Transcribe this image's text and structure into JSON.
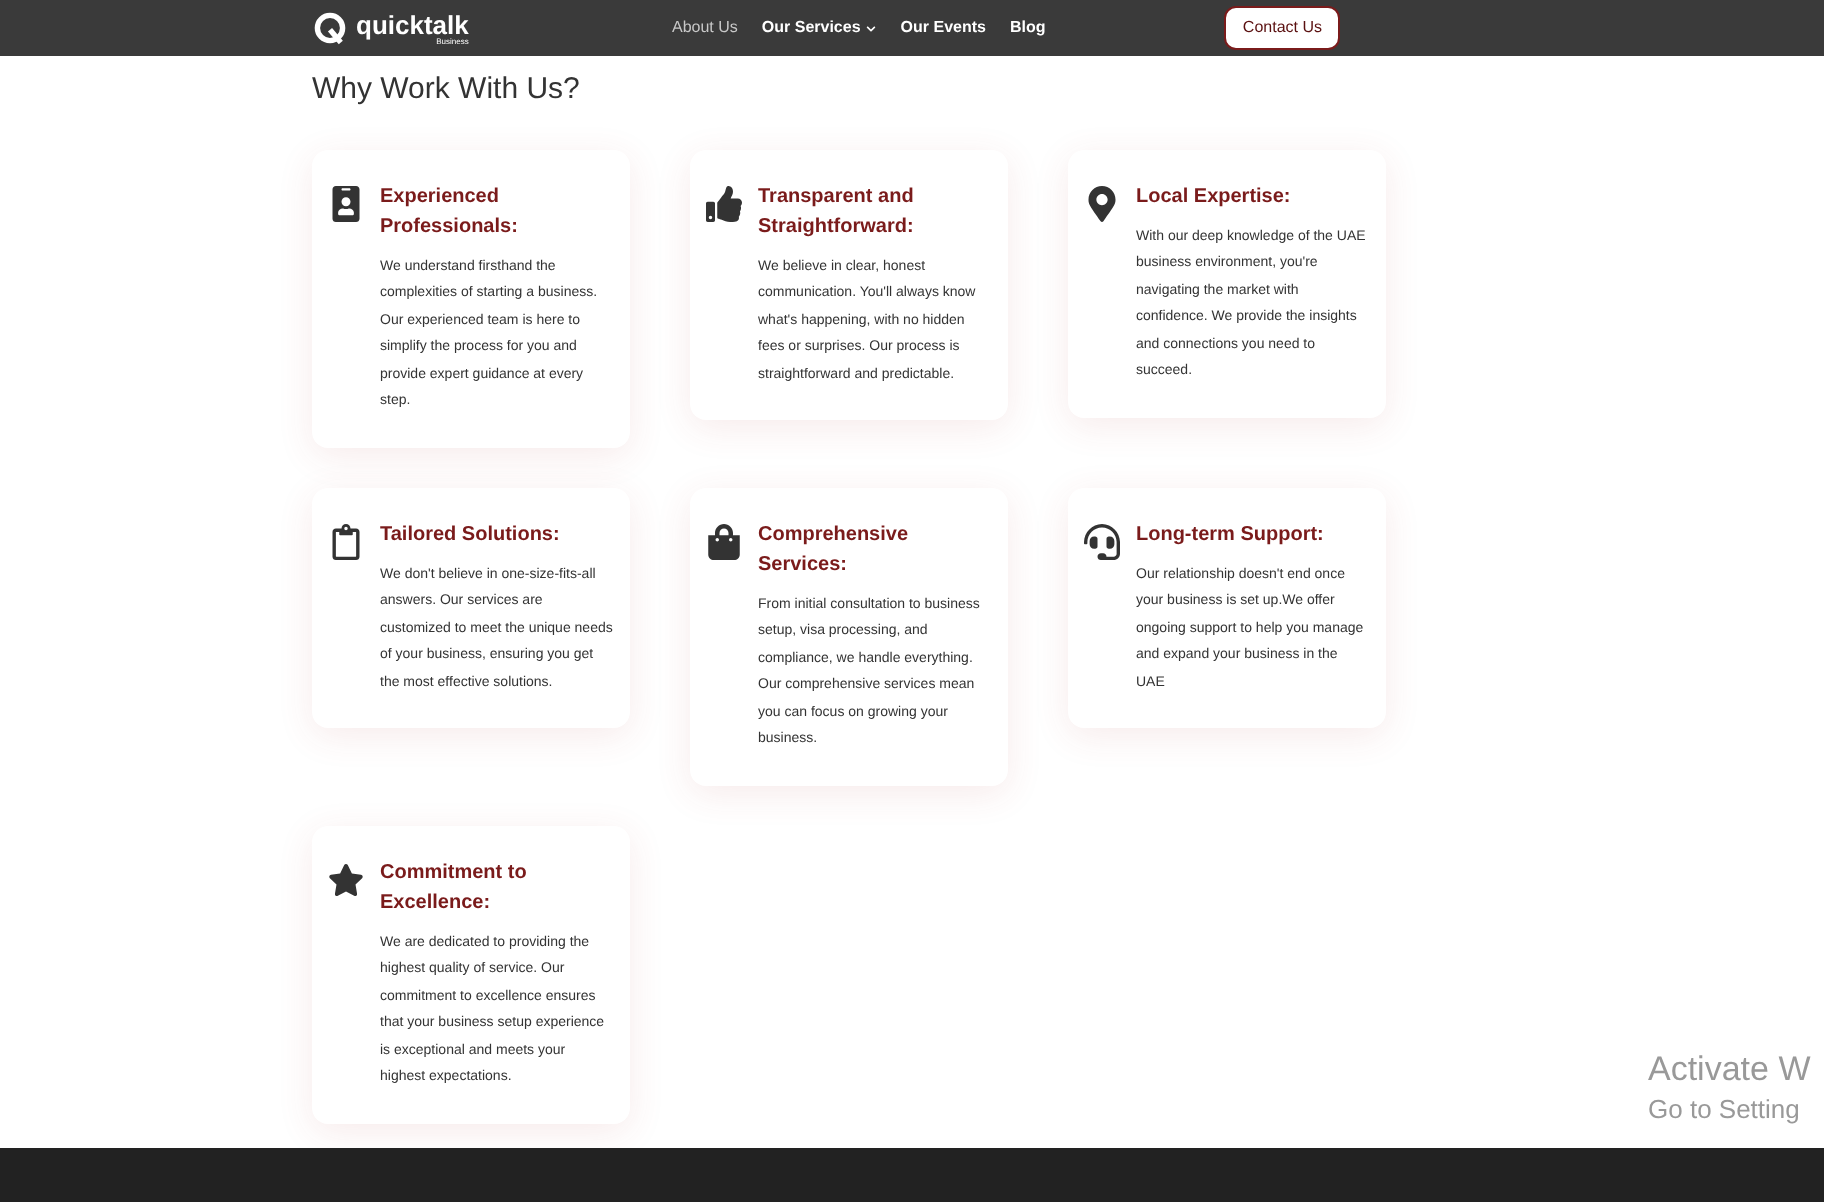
{
  "header": {
    "logo": {
      "name": "quicktalk",
      "tagline": "Business"
    },
    "nav": [
      {
        "label": "About Us",
        "selected": true,
        "dropdown": false
      },
      {
        "label": "Our Services",
        "selected": false,
        "dropdown": true
      },
      {
        "label": "Our Events",
        "selected": false,
        "dropdown": false
      },
      {
        "label": "Blog",
        "selected": false,
        "dropdown": false
      }
    ],
    "cta": "Contact Us"
  },
  "section": {
    "title": "Why Work With Us?",
    "cards": [
      {
        "title": "Experienced Professionals:",
        "body": "We understand firsthand the complexities of starting a business. Our experienced team is here to simplify the process for you and provide expert guidance at every step."
      },
      {
        "title": "Transparent and Straightforward:",
        "body": "We believe in clear, honest communication. You'll always know what's happening, with no hidden fees or surprises. Our process is straightforward and predictable."
      },
      {
        "title": "Local Expertise:",
        "body": "With our deep knowledge of the UAE business environment, you're navigating the market with confidence. We provide the insights and connections you need to succeed."
      },
      {
        "title": "Tailored Solutions:",
        "body": "We don't believe in one-size-fits-all answers. Our services are customized to meet the unique needs of your business, ensuring you get the most effective solutions."
      },
      {
        "title": "Comprehensive Services:",
        "body": "From initial consultation to business setup, visa processing, and compliance, we handle everything. Our comprehensive services mean you can focus on growing your business."
      },
      {
        "title": "Long-term Support:",
        "body": "Our relationship doesn't end once your business is set up.We offer ongoing support to help you manage and expand your business in the UAE"
      },
      {
        "title": "Commitment to Excellence:",
        "body": "We are dedicated to providing the highest quality of service. Our commitment to excellence ensures that your business setup experience is exceptional and meets your highest expectations."
      }
    ]
  },
  "os_notice": {
    "title": "Activate W",
    "subtitle": "Go to Setting"
  }
}
